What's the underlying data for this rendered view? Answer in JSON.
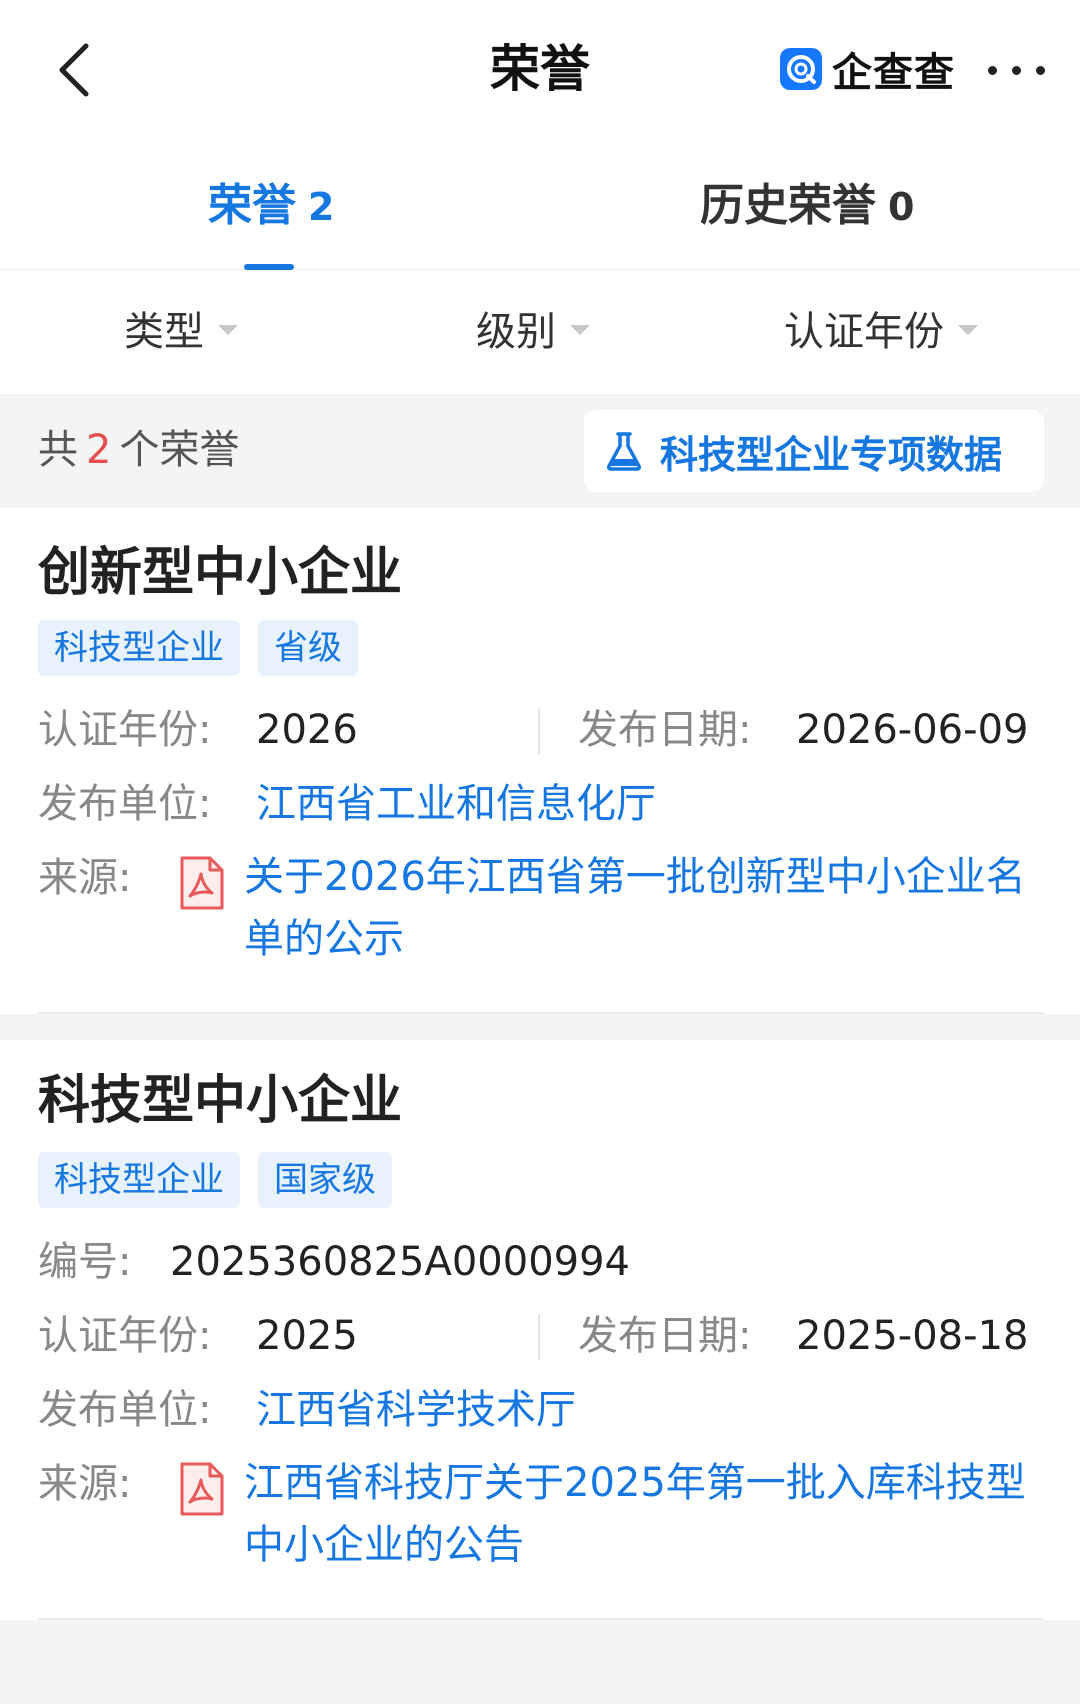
{
  "header": {
    "title": "荣誉",
    "brand_name": "企查查"
  },
  "tabs": [
    {
      "label": "荣誉",
      "count": "2",
      "active": true
    },
    {
      "label": "历史荣誉",
      "count": "0",
      "active": false
    }
  ],
  "filters": [
    "类型",
    "级别",
    "认证年份"
  ],
  "summary": {
    "prefix": "共",
    "count": "2",
    "suffix": "个荣誉",
    "special_button": "科技型企业专项数据"
  },
  "colors": {
    "accent": "#1677e0",
    "count_red": "#e84d4d",
    "pdf_red": "#e85a5a"
  },
  "cards": [
    {
      "title": "创新型中小企业",
      "tags": [
        "科技型企业",
        "省级"
      ],
      "year_label": "认证年份:",
      "year": "2026",
      "date_label": "发布日期:",
      "date": "2026-06-09",
      "issuer_label": "发布单位:",
      "issuer": "江西省工业和信息化厅",
      "source_label": "来源:",
      "source": "关于2026年江西省第一批创新型中小企业名单的公示"
    },
    {
      "title": "科技型中小企业",
      "tags": [
        "科技型企业",
        "国家级"
      ],
      "number_label": "编号:",
      "number": "2025360825A0000994",
      "year_label": "认证年份:",
      "year": "2025",
      "date_label": "发布日期:",
      "date": "2025-08-18",
      "issuer_label": "发布单位:",
      "issuer": "江西省科学技术厅",
      "source_label": "来源:",
      "source": "江西省科技厅关于2025年第一批入库科技型中小企业的公告"
    }
  ]
}
